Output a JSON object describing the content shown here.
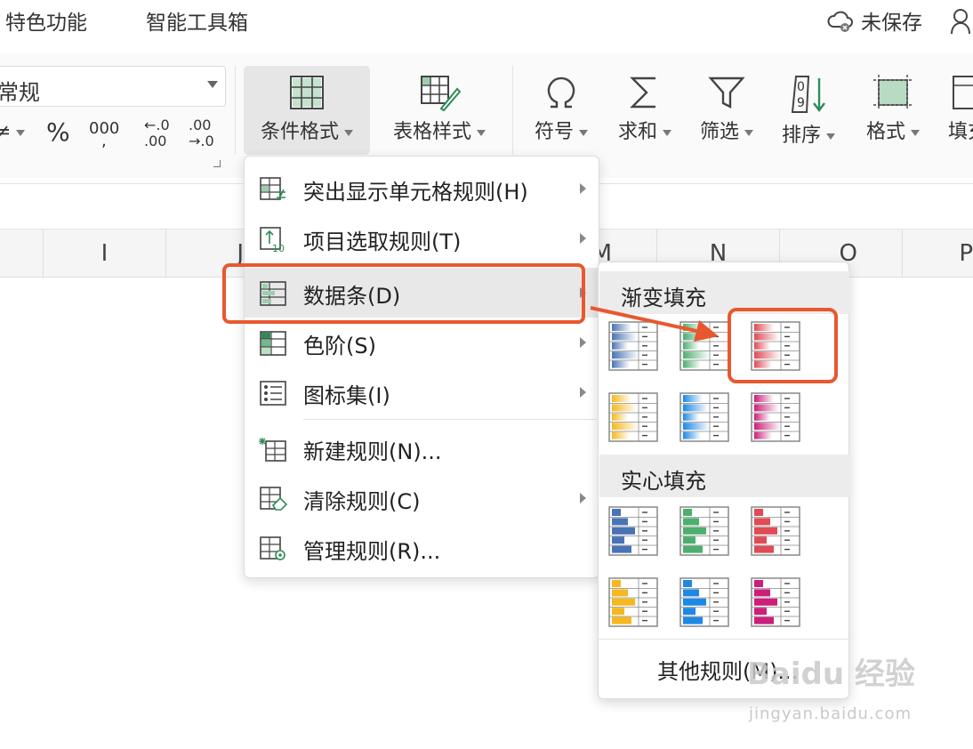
{
  "top_tabs": [
    "特色功能",
    "智能工具箱"
  ],
  "save_status": "未保存",
  "ribbon": {
    "number_format_value": "常规",
    "percent": "%",
    "thousands": "000",
    "decimal_increase": "←.0\n.00",
    "decimal_decrease": ".00\n→.0",
    "buttons": [
      {
        "label": "条件格式",
        "icon": "conditional-format-icon"
      },
      {
        "label": "表格样式",
        "icon": "table-style-icon"
      },
      {
        "label": "符号",
        "icon": "omega-icon"
      },
      {
        "label": "求和",
        "icon": "sigma-icon"
      },
      {
        "label": "筛选",
        "icon": "filter-icon"
      },
      {
        "label": "排序",
        "icon": "sort-icon"
      },
      {
        "label": "格式",
        "icon": "format-icon"
      },
      {
        "label": "填充",
        "icon": "fill-icon"
      }
    ]
  },
  "columns": [
    "I",
    "J",
    "M",
    "N",
    "O",
    "P"
  ],
  "menu": {
    "items": [
      {
        "label": "突出显示单元格规则(H)",
        "icon": "highlight-rules-icon",
        "submenu": true
      },
      {
        "label": "项目选取规则(T)",
        "icon": "top-rules-icon",
        "submenu": true
      },
      {
        "label": "数据条(D)",
        "icon": "data-bar-icon",
        "submenu": true
      },
      {
        "label": "色阶(S)",
        "icon": "color-scale-icon",
        "submenu": true
      },
      {
        "label": "图标集(I)",
        "icon": "icon-set-icon",
        "submenu": true
      },
      {
        "label": "新建规则(N)...",
        "icon": "new-rule-icon",
        "submenu": false
      },
      {
        "label": "清除规则(C)",
        "icon": "clear-rules-icon",
        "submenu": true
      },
      {
        "label": "管理规则(R)...",
        "icon": "manage-rules-icon",
        "submenu": false
      }
    ]
  },
  "submenu": {
    "gradient_header": "渐变填充",
    "solid_header": "实心填充",
    "more_rules": "其他规则(M)...",
    "gradient_colors": [
      "#4a73b5",
      "#4caf6e",
      "#e04b55",
      "#f5b820",
      "#1e88e5",
      "#cc1f7a"
    ],
    "solid_colors": [
      "#4a73b5",
      "#4caf6e",
      "#e04b55",
      "#f5b820",
      "#1e88e5",
      "#cc1f7a"
    ]
  },
  "watermark": {
    "brand": "Baidu 经验",
    "url": "jingyan.baidu.com"
  },
  "colors": {
    "highlight": "#e8582e",
    "excel_green": "#2e8b57"
  }
}
